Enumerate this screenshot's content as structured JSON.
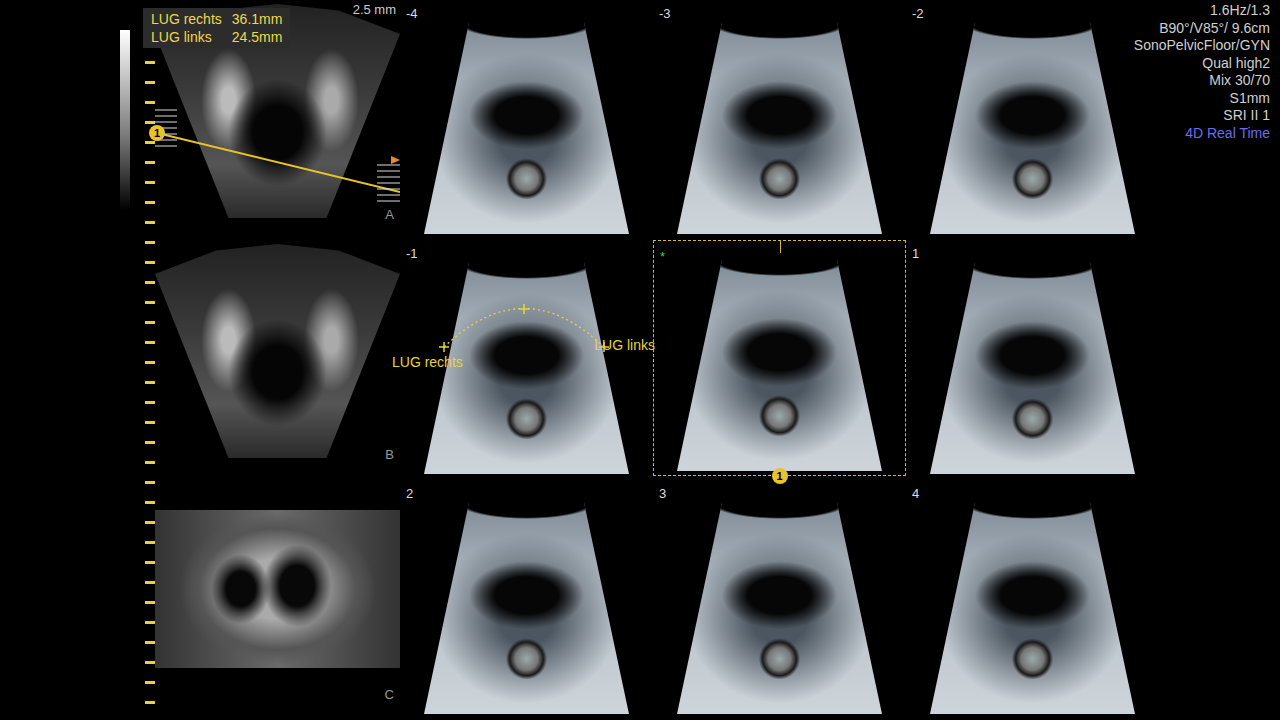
{
  "measurement_box": [
    {
      "name": "LUG rechts",
      "value": "36.1mm"
    },
    {
      "name": "LUG links",
      "value": "24.5mm"
    }
  ],
  "slice_thickness": "2.5 mm",
  "info": [
    "1.6Hz/1.3",
    "B90°/V85°/ 9.6cm",
    "SonoPelvicFloor/GYN",
    "Qual high2",
    "Mix 30/70",
    "S1mm",
    "SRI II 1"
  ],
  "mode": "4D Real Time",
  "reference_marker": "1",
  "planes": [
    {
      "label": "A",
      "kind": "sector"
    },
    {
      "label": "B",
      "kind": "sector"
    },
    {
      "label": "C",
      "kind": "rectangle"
    }
  ],
  "slices": [
    {
      "index": "-4",
      "selected": false,
      "labels": []
    },
    {
      "index": "-3",
      "selected": false,
      "labels": []
    },
    {
      "index": "-2",
      "selected": false,
      "labels": []
    },
    {
      "index": "-1",
      "selected": false,
      "labels": [
        "LUG rechts",
        "LUG links"
      ]
    },
    {
      "index": "*",
      "selected": true,
      "labels": []
    },
    {
      "index": "1",
      "selected": false,
      "labels": []
    },
    {
      "index": "2",
      "selected": false,
      "labels": []
    },
    {
      "index": "3",
      "selected": false,
      "labels": []
    },
    {
      "index": "4",
      "selected": false,
      "labels": []
    }
  ]
}
